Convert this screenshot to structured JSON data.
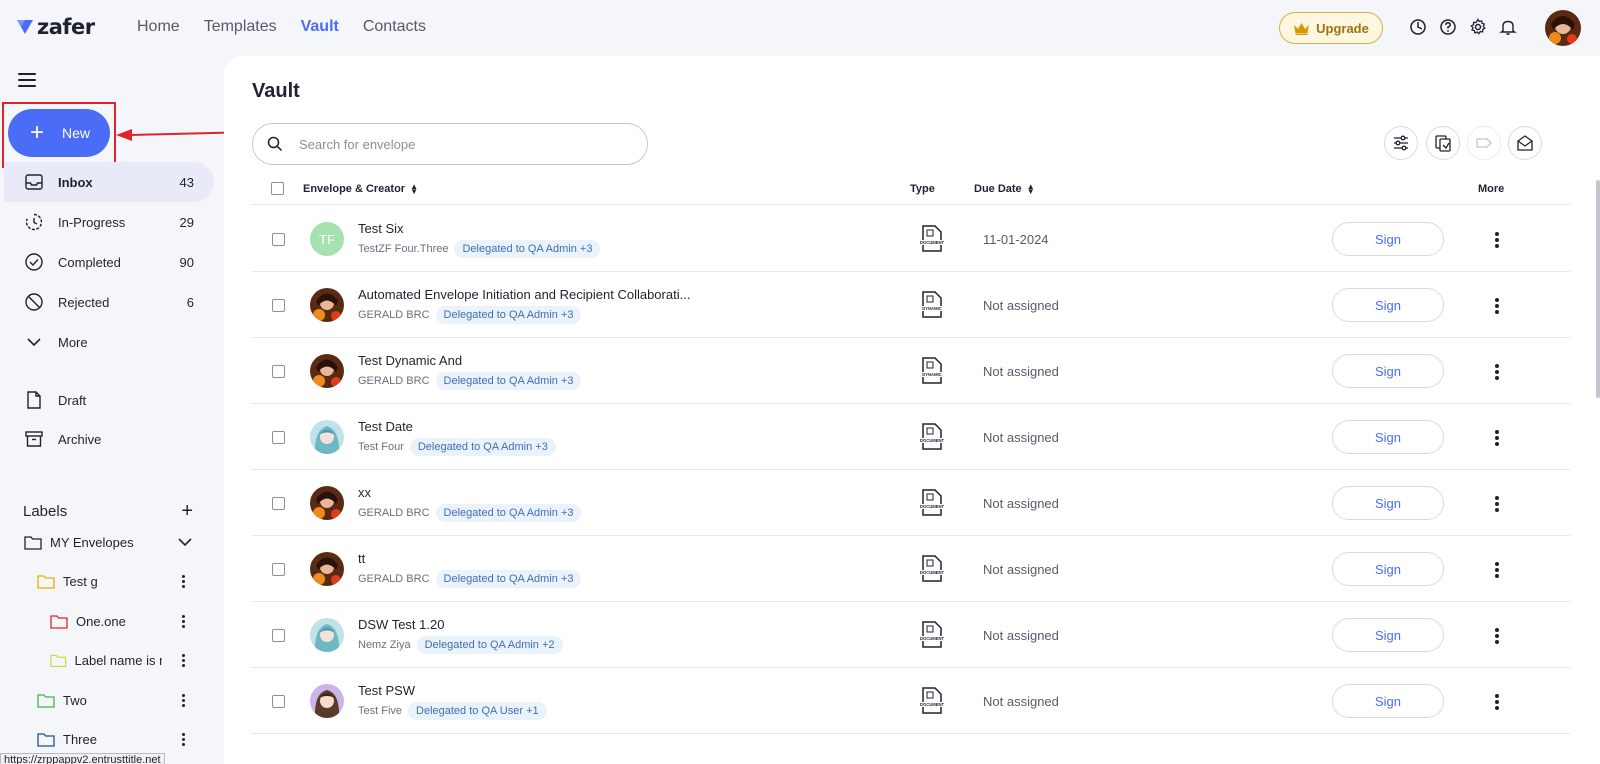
{
  "app": {
    "logo_text": "zafer",
    "brand_color": "#4a6cf7"
  },
  "nav": [
    {
      "label": "Home",
      "active": false
    },
    {
      "label": "Templates",
      "active": false
    },
    {
      "label": "Vault",
      "active": true
    },
    {
      "label": "Contacts",
      "active": false
    }
  ],
  "header": {
    "upgrade_label": "Upgrade",
    "icons": [
      "history-icon",
      "help-icon",
      "settings-icon",
      "bell-icon"
    ]
  },
  "sidebar": {
    "new_label": "New",
    "folders": [
      {
        "label": "Inbox",
        "count": "43",
        "icon": "inbox-icon",
        "active": true
      },
      {
        "label": "In-Progress",
        "count": "29",
        "icon": "clock-icon"
      },
      {
        "label": "Completed",
        "count": "90",
        "icon": "check-circle-icon"
      },
      {
        "label": "Rejected",
        "count": "6",
        "icon": "ban-icon"
      },
      {
        "label": "More",
        "count": "",
        "icon": "chevron-down-icon"
      }
    ],
    "secondary": [
      {
        "label": "Draft",
        "icon": "file-icon"
      },
      {
        "label": "Archive",
        "icon": "archive-icon"
      }
    ],
    "labels_title": "Labels",
    "labels": [
      {
        "label": "MY Envelopes",
        "color": "#1f2330"
      },
      {
        "label": "Test g",
        "color": "#e8b100"
      },
      {
        "label": "One.one",
        "color": "#e0242b"
      },
      {
        "label": "Label name is m",
        "color": "#c8dc3c"
      },
      {
        "label": "Two",
        "color": "#3cb84a"
      },
      {
        "label": "Three",
        "color": "#1f4fa0"
      }
    ],
    "status_url": "https://zrppappv2.entrusttitle.net"
  },
  "main": {
    "title": "Vault",
    "search_placeholder": "Search for envelope",
    "columns": {
      "envelope": "Envelope & Creator",
      "type": "Type",
      "due": "Due Date",
      "more": "More"
    },
    "sign_label": "Sign",
    "rows": [
      {
        "title": "Test Six",
        "creator": "TestZF Four.Three",
        "tag": "Delegated to QA Admin +3",
        "type": "DOCUMENT",
        "due": "11-01-2024",
        "avatar": "TF"
      },
      {
        "title": "Automated Envelope Initiation and Recipient Collaborati...",
        "creator": "GERALD BRC",
        "tag": "Delegated to QA Admin +3",
        "type": "DYNAMIC",
        "due": "Not assigned",
        "avatar": ""
      },
      {
        "title": "Test Dynamic And",
        "creator": "GERALD BRC",
        "tag": "Delegated to QA Admin +3",
        "type": "DYNAMIC",
        "due": "Not assigned",
        "avatar": ""
      },
      {
        "title": "Test Date",
        "creator": "Test Four",
        "tag": "Delegated to QA Admin +3",
        "type": "DOCUMENT",
        "due": "Not assigned",
        "avatar": ""
      },
      {
        "title": "xx",
        "creator": "GERALD BRC",
        "tag": "Delegated to QA Admin +3",
        "type": "DOCUMENT",
        "due": "Not assigned",
        "avatar": ""
      },
      {
        "title": "tt",
        "creator": "GERALD BRC",
        "tag": "Delegated to QA Admin +3",
        "type": "DOCUMENT",
        "due": "Not assigned",
        "avatar": ""
      },
      {
        "title": "DSW Test 1.20",
        "creator": "Nemz Ziya",
        "tag": "Delegated to QA Admin +2",
        "type": "DOCUMENT",
        "due": "Not assigned",
        "avatar": ""
      },
      {
        "title": "Test PSW",
        "creator": "Test Five",
        "tag": "Delegated to QA User +1",
        "type": "DOCUMENT",
        "due": "Not assigned",
        "avatar": ""
      }
    ]
  }
}
